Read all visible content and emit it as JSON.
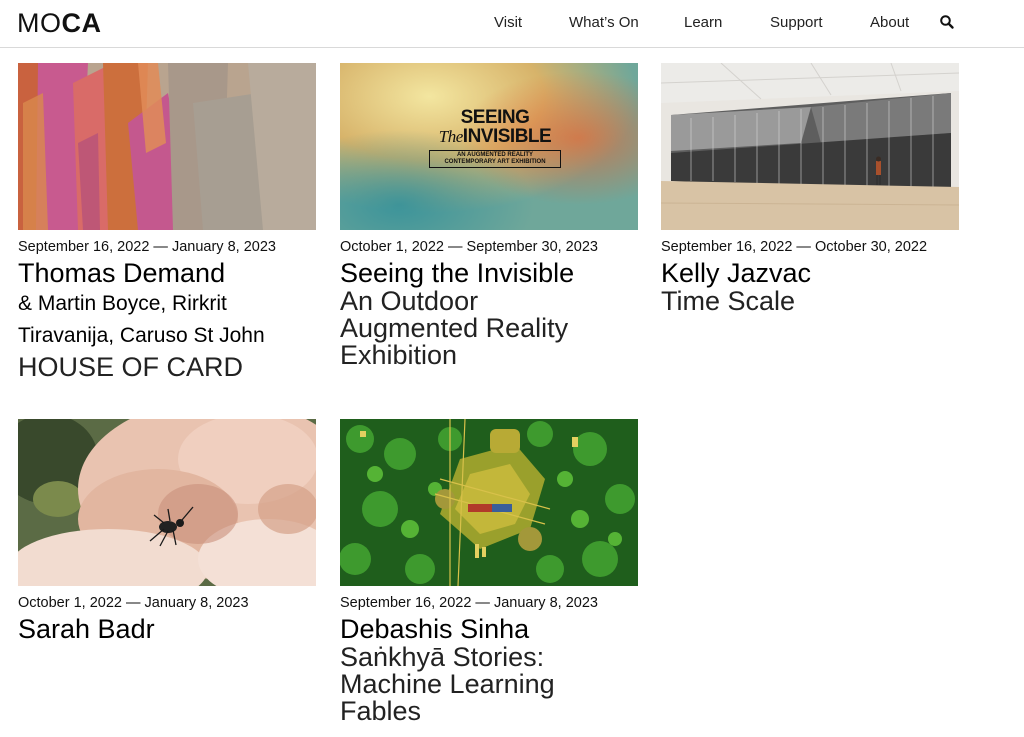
{
  "header": {
    "logo_prefix": "MO",
    "logo_suffix": "CA",
    "nav": [
      {
        "label": "Visit"
      },
      {
        "label": "What’s On"
      },
      {
        "label": "Learn"
      },
      {
        "label": "Support"
      },
      {
        "label": "About"
      }
    ],
    "search_icon": "search-icon"
  },
  "exhibitions": [
    {
      "dates": "September 16, 2022 — January 8, 2023",
      "artist": "Thomas Demand",
      "co_artists_line1": "& Martin Boyce, Rirkrit",
      "co_artists_line2": "Tiravanija, Caruso St John",
      "title": "HOUSE OF CARD"
    },
    {
      "dates": "October 1, 2022 — September 30, 2023",
      "artist": "Seeing the Invisible",
      "title_line1": "An Outdoor",
      "title_line2": "Augmented Reality",
      "title_line3": "Exhibition",
      "poster": {
        "headline1": "SEEING",
        "headline_the": "The",
        "headline2": "INVISIBLE",
        "subline1": "AN AUGMENTED REALITY",
        "subline2": "CONTEMPORARY ART EXHIBITION"
      }
    },
    {
      "dates": "September 16, 2022 — October 30, 2022",
      "artist": "Kelly Jazvac",
      "title": "Time Scale"
    },
    {
      "dates": "October 1, 2022 — January 8, 2023",
      "artist": "Sarah Badr"
    },
    {
      "dates": "September 16, 2022 — January 8, 2023",
      "artist": "Debashis Sinha",
      "title_line1": "Saṅkhyā Stories:",
      "title_line2": "Machine Learning",
      "title_line3": "Fables"
    }
  ]
}
